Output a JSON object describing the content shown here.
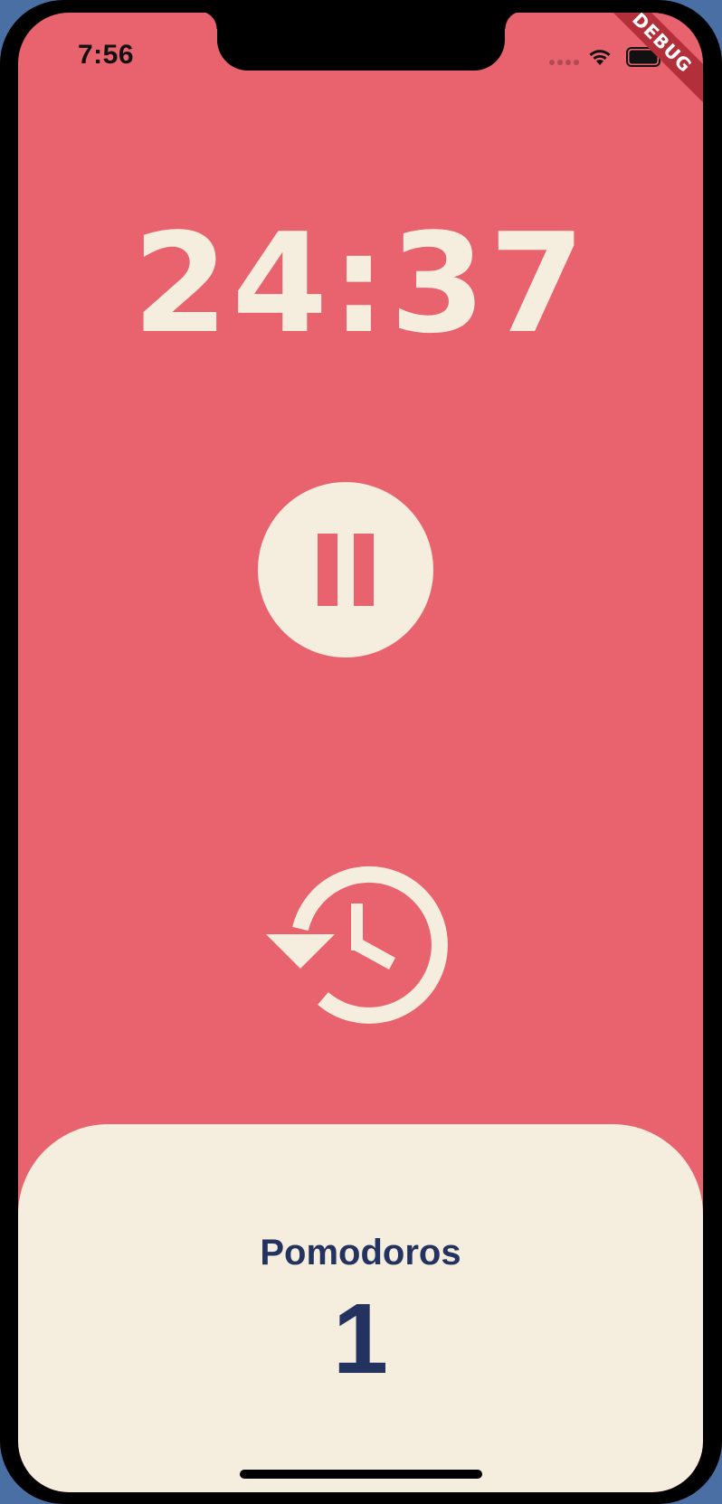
{
  "status_bar": {
    "time": "7:56"
  },
  "debug_banner": {
    "label": "DEBUG"
  },
  "timer": {
    "display": "24:37"
  },
  "controls": {
    "pause_icon": "pause-icon",
    "reset_icon": "history-icon"
  },
  "stats": {
    "label": "Pomodoros",
    "count": "1"
  },
  "colors": {
    "background": "#e8636e",
    "cream": "#f5eedf",
    "navy": "#24325f",
    "debug_red": "#b3303b"
  }
}
